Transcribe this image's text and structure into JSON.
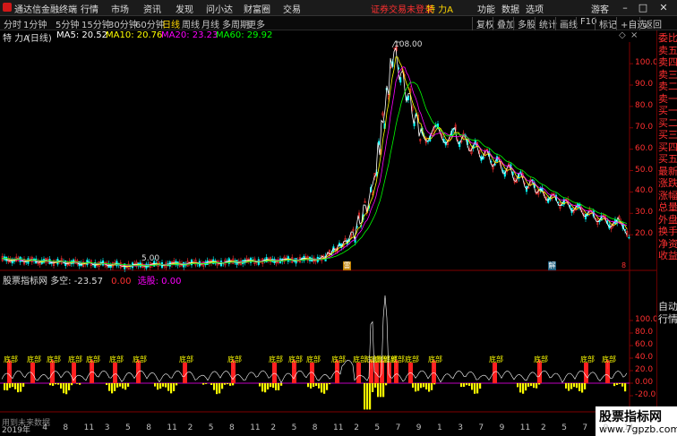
{
  "app": {
    "title": "通达信金融终端",
    "menus": [
      "行情",
      "市场",
      "资讯",
      "发现",
      "问小达",
      "财富圈",
      "交易"
    ],
    "warning": "证券交易未登录",
    "stock_tab": "特 力A",
    "right_menus": [
      "功能",
      "数据",
      "选项"
    ],
    "guest": "游客"
  },
  "toolbar": {
    "periods": [
      "分时",
      "1分钟",
      "5分钟",
      "15分钟",
      "30分钟",
      "60分钟",
      "日线",
      "周线",
      "月线",
      "多周期",
      "更多"
    ],
    "right": [
      "复权",
      "叠加",
      "多股",
      "统计",
      "画线",
      "F10",
      "标记",
      "+自选",
      "返回"
    ]
  },
  "info": {
    "stock": "特 力A",
    "period": "(日线)",
    "ma5": "MA5: 20.52",
    "ma10": "MA10: 20.76",
    "ma20": "MA20: 23.23",
    "ma60": "MA60: 29.92"
  },
  "colors": {
    "ma5": "#ffffff",
    "ma10": "#ffff00",
    "ma20": "#ff00ff",
    "ma60": "#00ff00",
    "up": "#ff3030",
    "down": "#00ffff"
  },
  "main_chart": {
    "peak_label": "108.00",
    "low_label": "5.00",
    "y_ticks": [
      "100.0",
      "90.0",
      "80.0",
      "70.0",
      "60.0",
      "50.0",
      "40.0",
      "30.0",
      "20.0"
    ],
    "markers": [
      "雷",
      "解",
      "8"
    ]
  },
  "indicator": {
    "name": "股票指标网",
    "label": "多空: -23.57",
    "v1": "0.00",
    "v2_label": "选股: 0.00",
    "y_ticks": [
      "100.0",
      "80.0",
      "60.0",
      "40.0",
      "20.0",
      "0.00",
      "-20.0"
    ],
    "signal": "底部"
  },
  "side": {
    "labels": [
      "委比",
      "卖五",
      "卖四",
      "卖三",
      "卖二",
      "卖一",
      "买一",
      "买二",
      "买三",
      "买四",
      "买五",
      "最新",
      "涨跌",
      "涨幅",
      "总量",
      "外盘",
      "换手",
      "净资",
      "收益"
    ],
    "extra": [
      "自动",
      "行情"
    ]
  },
  "footer": {
    "hint": "用到未来数据",
    "axis": [
      "2019年",
      "4",
      "8",
      "11",
      "3",
      "5",
      "8",
      "11",
      "2",
      "5",
      "8",
      "11",
      "2",
      "5",
      "8",
      "11",
      "2",
      "5",
      "7",
      "9",
      "1",
      "3",
      "7",
      "9",
      "11",
      "2",
      "5",
      "7",
      "9",
      "11"
    ]
  },
  "watermark": {
    "title": "股票指标网",
    "url": "www.7gpzb.com"
  }
}
